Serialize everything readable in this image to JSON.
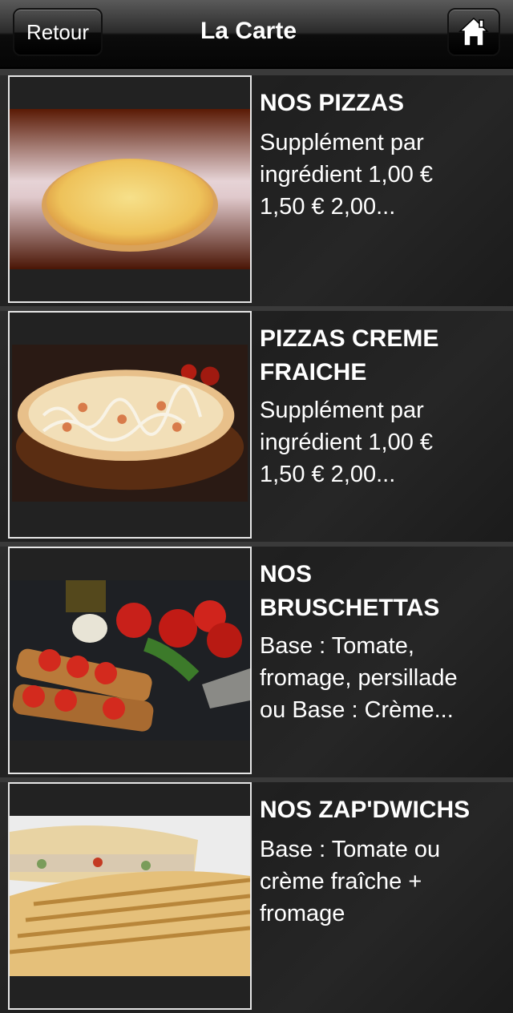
{
  "header": {
    "back_label": "Retour",
    "title": "La Carte",
    "home_icon": "home-icon"
  },
  "items": [
    {
      "title": "NOS PIZZAS",
      "description": "Supplément par\ningrédient 1,00 €\n1,50 € 2,00...",
      "image": "pizza-cheese-photo"
    },
    {
      "title": "PIZZAS CREME\nFRAICHE",
      "description": "Supplément par\ningrédient 1,00 €\n1,50 € 2,00...",
      "image": "pizza-creme-fraiche-photo"
    },
    {
      "title": "NOS\nBRUSCHETTAS",
      "description": "Base : Tomate,\nfromage, persillade\nou Base : Crème...",
      "image": "bruschetta-photo"
    },
    {
      "title": "NOS ZAP'DWICHS",
      "description": "Base : Tomate ou\ncrème fraîche +\nfromage",
      "image": "panini-photo"
    }
  ],
  "colors": {
    "card_bg": "#232323",
    "text": "#ffffff",
    "thumb_border": "#e6e6e6"
  }
}
